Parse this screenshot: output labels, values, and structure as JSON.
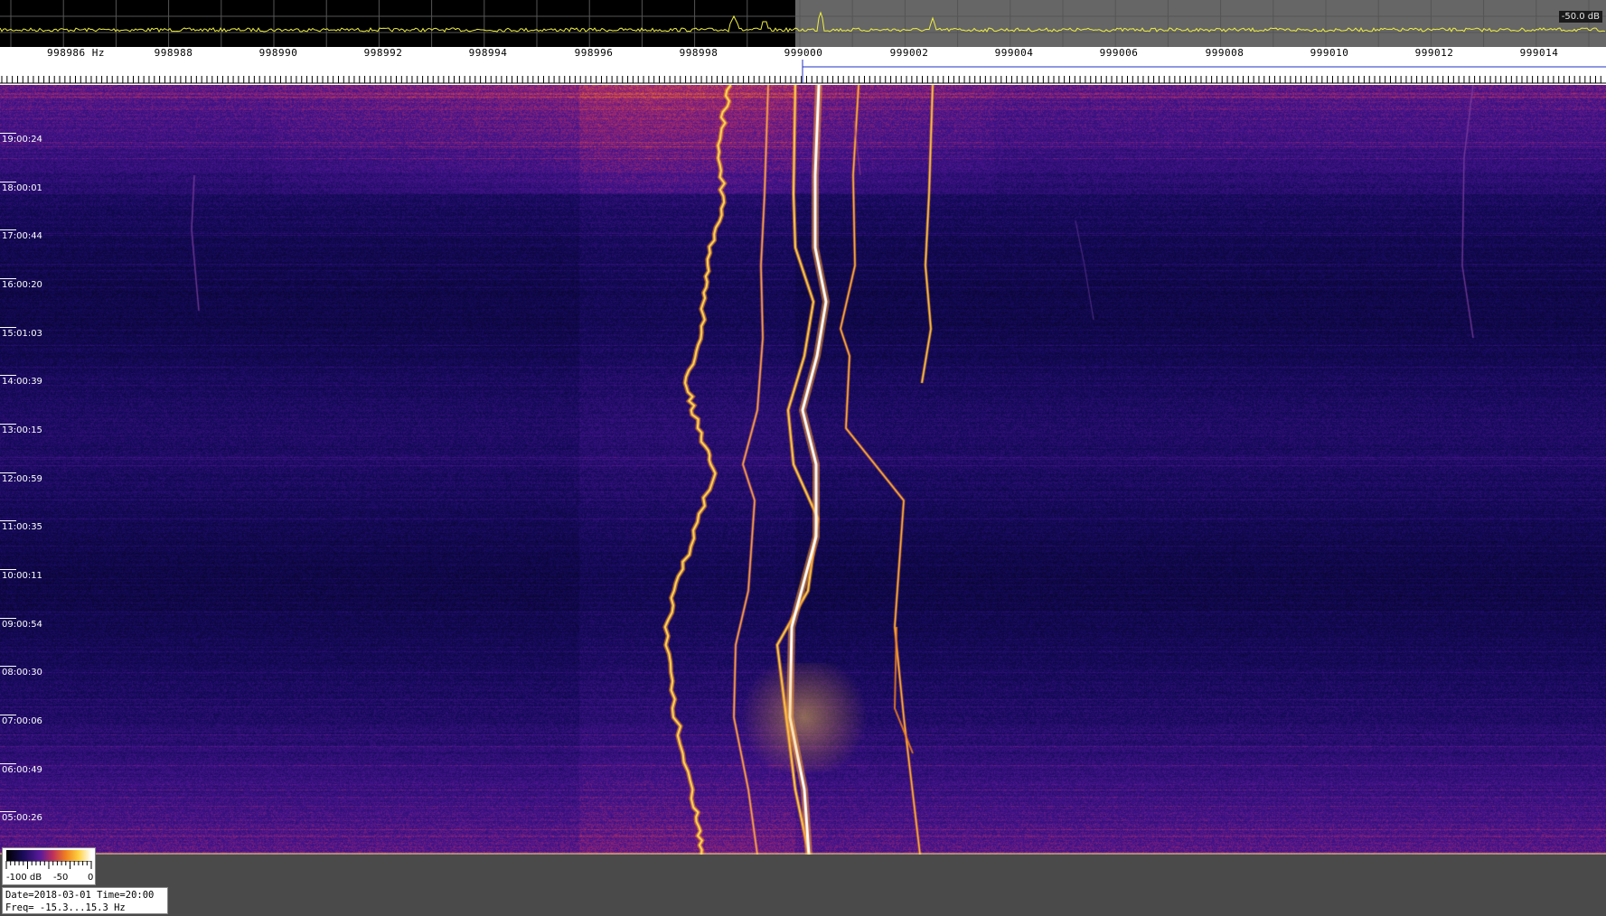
{
  "spectrum": {
    "db_reference": "-50.0 dB",
    "colors": {
      "trace": "#f0f040",
      "grid": "#555555",
      "background_left": "#000000",
      "background_right": "#666666"
    }
  },
  "frequency_axis": {
    "unit": "Hz",
    "first_label": "998986 Hz",
    "tick_labels": [
      "998988",
      "998990",
      "998992",
      "998994",
      "998996",
      "998998",
      "999000",
      "999002",
      "999004",
      "999006",
      "999008",
      "999010",
      "999012",
      "999014"
    ]
  },
  "waterfall": {
    "time_labels": [
      "19:00:24",
      "18:00:01",
      "17:00:44",
      "16:00:20",
      "15:01:03",
      "14:00:39",
      "13:00:15",
      "12:00:59",
      "11:00:35",
      "10:00:11",
      "09:00:54",
      "08:00:30",
      "07:00:06",
      "06:00:49",
      "05:00:26"
    ]
  },
  "colorbar": {
    "min_label": "-100 dB",
    "mid_label": "-50",
    "max_label": "0"
  },
  "info": {
    "date_time": "Date=2018-03-01 Time=20:00",
    "freq_range": "Freq= -15.3...15.3 Hz"
  }
}
